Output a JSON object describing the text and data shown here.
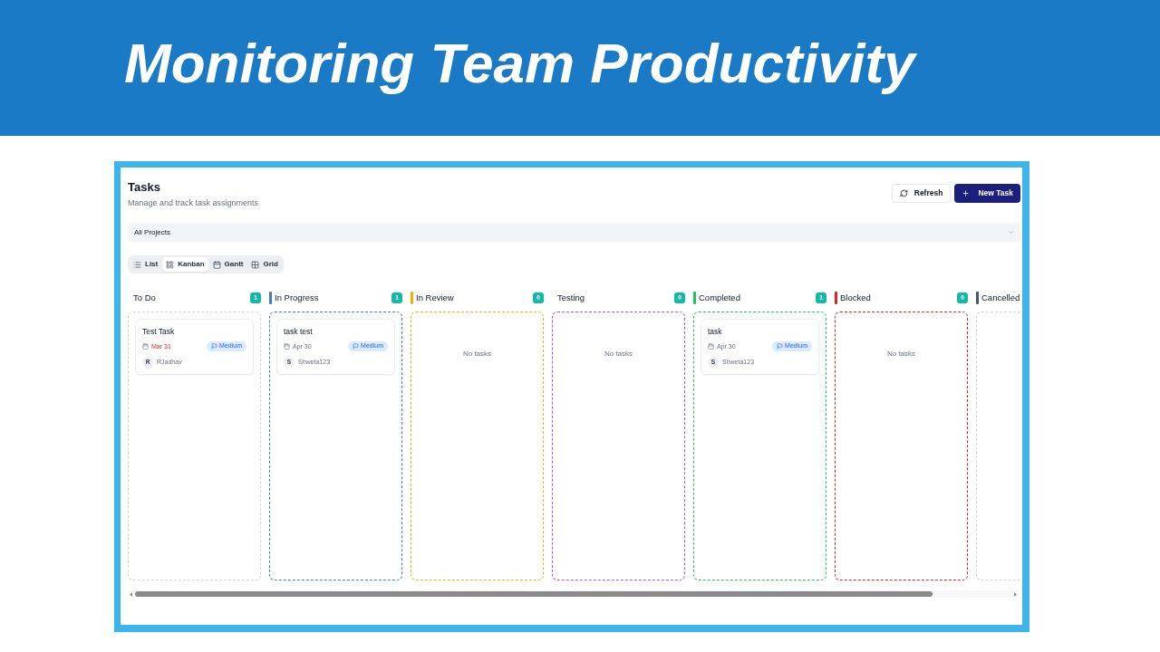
{
  "banner": {
    "title": "Monitoring Team Productivity"
  },
  "header": {
    "title": "Tasks",
    "subtitle": "Manage and track task assignments"
  },
  "actions": [
    {
      "kind": "refresh",
      "label": "Refresh"
    },
    {
      "kind": "create",
      "label": "New Task"
    }
  ],
  "project_filter": {
    "value": "All Projects"
  },
  "views": [
    {
      "kind": "list",
      "label": "List",
      "selected": false
    },
    {
      "kind": "kanban",
      "label": "Kanban",
      "selected": true
    },
    {
      "kind": "gantt",
      "label": "Gantt",
      "selected": false
    },
    {
      "kind": "grid",
      "label": "Grid",
      "selected": false
    }
  ],
  "columns": [
    {
      "title": "To Do",
      "count": "1",
      "color": "#d1d5db",
      "tasks": [
        {
          "title": "Test Task",
          "due": "Mar 31",
          "overdue": true,
          "priority": "Medium",
          "initial": "R",
          "assignee": "RJadhav"
        }
      ]
    },
    {
      "title": "In Progress",
      "count": "1",
      "bar": {
        "color": "#3b82c4"
      },
      "color": "#3b82c4",
      "tasks": [
        {
          "title": "task test",
          "due": "Apr 30",
          "overdue": false,
          "priority": "Medium",
          "initial": "S",
          "assignee": "Shweta123"
        }
      ]
    },
    {
      "title": "In Review",
      "count": "0",
      "bar": {
        "color": "#eab308"
      },
      "color": "#eab308",
      "empty_text": "No tasks"
    },
    {
      "title": "Testing",
      "count": "0",
      "color": "#a855f7",
      "empty_text": "No tasks"
    },
    {
      "title": "Completed",
      "count": "1",
      "bar": {
        "color": "#22c55e"
      },
      "color": "#22c55e",
      "tasks": [
        {
          "title": "task",
          "due": "Apr 30",
          "overdue": false,
          "priority": "Medium",
          "initial": "S",
          "assignee": "Shweta123"
        }
      ]
    },
    {
      "title": "Blocked",
      "count": "0",
      "bar": {
        "color": "#dc2626"
      },
      "color": "#dc2626",
      "empty_text": "No tasks"
    },
    {
      "title": "Cancelled",
      "bar": {
        "color": "#4b5563"
      },
      "color": "#d1d5db"
    }
  ]
}
